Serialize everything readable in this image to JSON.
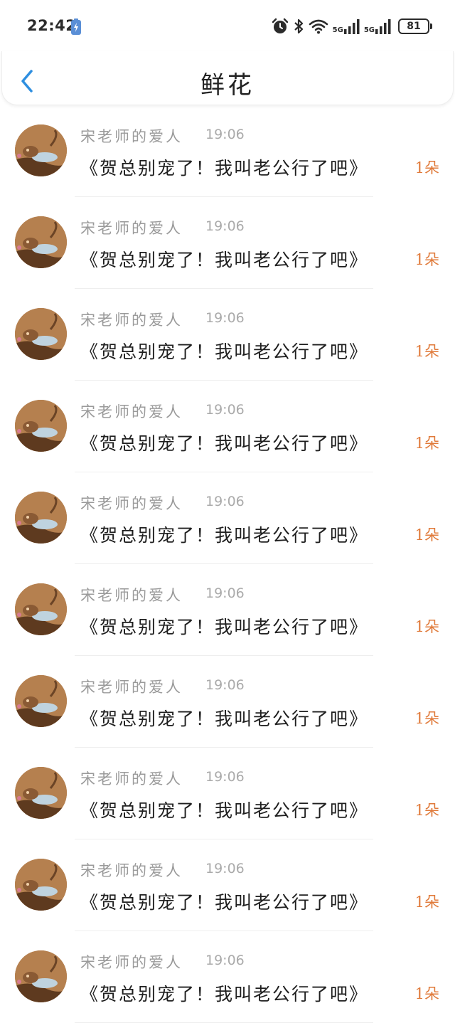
{
  "status_bar": {
    "time": "22:42",
    "network_1": "5G",
    "network_2": "5G",
    "battery_level": "81"
  },
  "header": {
    "title": "鲜花"
  },
  "list": {
    "items": [
      {
        "sender": "宋老师的爱人",
        "time": "19:06",
        "message": "《贺总别宠了！我叫老公行了吧》",
        "count": "1朵"
      },
      {
        "sender": "宋老师的爱人",
        "time": "19:06",
        "message": "《贺总别宠了！我叫老公行了吧》",
        "count": "1朵"
      },
      {
        "sender": "宋老师的爱人",
        "time": "19:06",
        "message": "《贺总别宠了！我叫老公行了吧》",
        "count": "1朵"
      },
      {
        "sender": "宋老师的爱人",
        "time": "19:06",
        "message": "《贺总别宠了！我叫老公行了吧》",
        "count": "1朵"
      },
      {
        "sender": "宋老师的爱人",
        "time": "19:06",
        "message": "《贺总别宠了！我叫老公行了吧》",
        "count": "1朵"
      },
      {
        "sender": "宋老师的爱人",
        "time": "19:06",
        "message": "《贺总别宠了！我叫老公行了吧》",
        "count": "1朵"
      },
      {
        "sender": "宋老师的爱人",
        "time": "19:06",
        "message": "《贺总别宠了！我叫老公行了吧》",
        "count": "1朵"
      },
      {
        "sender": "宋老师的爱人",
        "time": "19:06",
        "message": "《贺总别宠了！我叫老公行了吧》",
        "count": "1朵"
      },
      {
        "sender": "宋老师的爱人",
        "time": "19:06",
        "message": "《贺总别宠了！我叫老公行了吧》",
        "count": "1朵"
      },
      {
        "sender": "宋老师的爱人",
        "time": "19:06",
        "message": "《贺总别宠了！我叫老公行了吧》",
        "count": "1朵"
      }
    ]
  },
  "colors": {
    "accent_blue": "#2f8fe0",
    "count_orange": "#e07a3a",
    "sender_gray": "#9a9a9a"
  }
}
